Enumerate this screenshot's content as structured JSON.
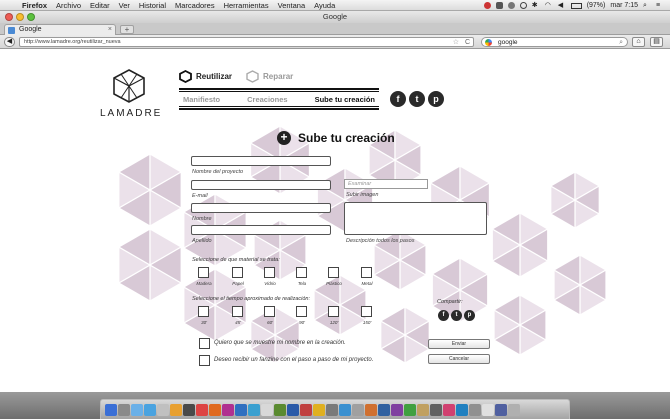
{
  "menubar": {
    "app": "Firefox",
    "items": [
      "Archivo",
      "Editar",
      "Ver",
      "Historial",
      "Marcadores",
      "Herramientas",
      "Ventana",
      "Ayuda"
    ],
    "battery": "(97%)",
    "clock": "mar 7:15"
  },
  "window": {
    "title": "Google"
  },
  "tab": {
    "title": "Google",
    "close": "×",
    "new_tab": "+"
  },
  "nav": {
    "back": "◀",
    "url": "http://www.lamadre.org/reutilizar_nueva",
    "star": "☆",
    "reload": "C",
    "search_value": "google",
    "home": "⌂"
  },
  "site": {
    "logo_text": "LAMADRE",
    "modes": [
      {
        "label": "Reutilizar",
        "active": true
      },
      {
        "label": "Reparar",
        "active": false
      }
    ],
    "nav_links": [
      "Manifiesto",
      "Creaciones",
      "Sube tu creación"
    ],
    "social": [
      "f",
      "t",
      "p"
    ],
    "heading": "Sube tu creación",
    "plus": "+"
  },
  "form": {
    "project_name_label": "Nombre del proyecto",
    "email_label": "E-mail",
    "name_label": "Nombre",
    "surname_label": "Apellido",
    "examinar_placeholder": "Examinar",
    "upload_label": "Subir imagen",
    "description_label": "Descripción todos los pasos",
    "material_question": "Seleccione de que material se trata:",
    "materials": [
      "Madera",
      "Papel",
      "Vidrio",
      "Tela",
      "Plástico",
      "Metal"
    ],
    "time_question": "Seleccione el tiempo aproximado de realización:",
    "times": [
      "30'",
      "45'",
      "60'",
      "90'",
      "120'",
      "150'"
    ],
    "share_label": "Compartir:",
    "share_icons": [
      "f",
      "t",
      "p"
    ],
    "check1": "Quiero que se muestre mi nombre en la creación.",
    "check2": "Deseo recibir un fanzine con el paso a paso de mi proyecto.",
    "send_button": "Enviar",
    "cancel_button": "Cancelar"
  },
  "colors": {
    "pattern": "#d8c9d6",
    "pattern_light": "#ebe1ea",
    "text": "#222222",
    "muted": "#999999"
  }
}
